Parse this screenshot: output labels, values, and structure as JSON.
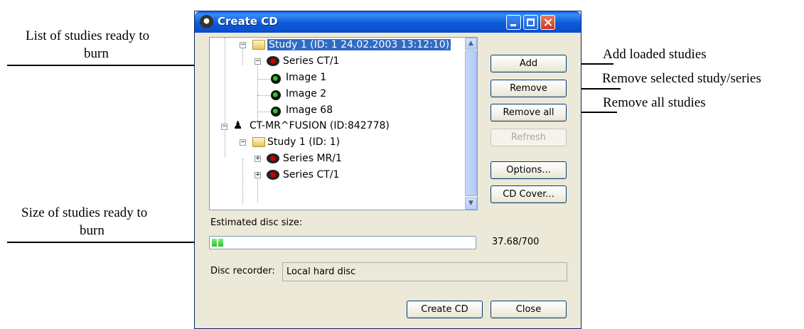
{
  "callouts": {
    "list_of_studies": [
      "List of studies ready to",
      "burn"
    ],
    "size_of_studies": [
      "Size of studies ready to",
      "burn"
    ],
    "add_loaded": "Add loaded studies",
    "remove_selected": "Remove selected study/series",
    "remove_all": "Remove all studies"
  },
  "window": {
    "title": "Create CD"
  },
  "tree": {
    "items": [
      {
        "label": "Study 1 (ID: 1 24.02.2003 13:12:10)",
        "icon": "folder-icon",
        "selected": true
      },
      {
        "label": "Series CT/1",
        "icon": "series-icon"
      },
      {
        "label": "Image 1",
        "icon": "image-icon"
      },
      {
        "label": "Image 2",
        "icon": "image-icon"
      },
      {
        "label": "Image 68",
        "icon": "image-icon"
      },
      {
        "label": "CT-MR^FUSION (ID:842778)",
        "icon": "patient-icon"
      },
      {
        "label": "Study 1 (ID: 1)",
        "icon": "folder-icon"
      },
      {
        "label": "Series MR/1",
        "icon": "series-icon"
      },
      {
        "label": "Series CT/1",
        "icon": "series-icon"
      }
    ]
  },
  "buttons": {
    "add": "Add",
    "remove": "Remove",
    "remove_all": "Remove all",
    "refresh": "Refresh",
    "options": "Options...",
    "cd_cover": "CD Cover...",
    "create_cd": "Create CD",
    "close": "Close"
  },
  "disc": {
    "estimated_label": "Estimated disc size:",
    "size_text": "37.68/700",
    "used_mb": 37.68,
    "capacity_mb": 700,
    "recorder_label": "Disc recorder:",
    "recorder_value": "Local hard disc"
  },
  "colors": {
    "selection": "#316ac5",
    "progress": "#2cbf2c",
    "titlebar": "#0a5fe8"
  }
}
